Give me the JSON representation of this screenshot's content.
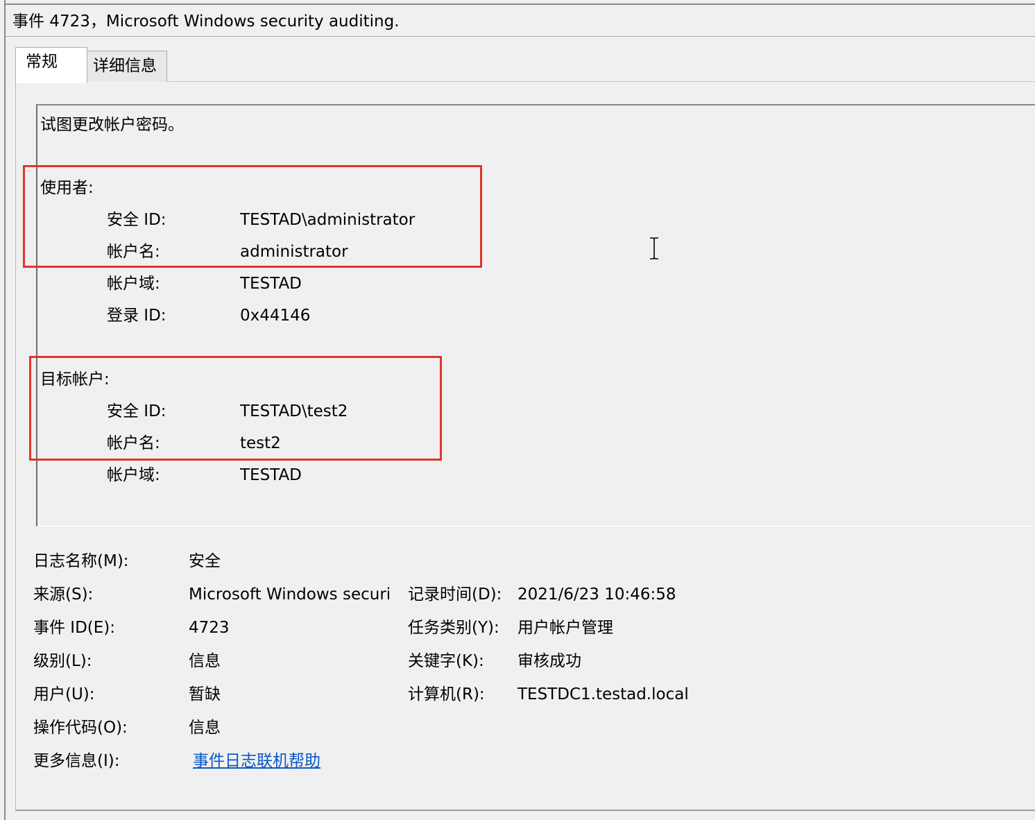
{
  "window": {
    "title": "事件 4723，Microsoft Windows security auditing."
  },
  "tabs": [
    {
      "label": "常规",
      "active": true
    },
    {
      "label": "详细信息",
      "active": false
    }
  ],
  "description": {
    "summary": "试图更改帐户密码。",
    "subject": {
      "heading": "使用者:",
      "fields": [
        {
          "label": "安全 ID:",
          "value": "TESTAD\\administrator"
        },
        {
          "label": "帐户名:",
          "value": "administrator"
        },
        {
          "label": "帐户域:",
          "value": "TESTAD"
        },
        {
          "label": "登录 ID:",
          "value": "0x44146"
        }
      ]
    },
    "target": {
      "heading": "目标帐户:",
      "fields": [
        {
          "label": "安全 ID:",
          "value": "TESTAD\\test2"
        },
        {
          "label": "帐户名:",
          "value": "test2"
        },
        {
          "label": "帐户域:",
          "value": "TESTAD"
        }
      ]
    },
    "highlight_color": "#e0342b"
  },
  "properties": {
    "log_name": {
      "label": "日志名称(M):",
      "value": "安全"
    },
    "source": {
      "label": "来源(S):",
      "value": "Microsoft Windows securi"
    },
    "logged": {
      "label": "记录时间(D):",
      "value": "2021/6/23 10:46:58"
    },
    "event_id": {
      "label": "事件 ID(E):",
      "value": "4723"
    },
    "task_category": {
      "label": "任务类别(Y):",
      "value": "用户帐户管理"
    },
    "level": {
      "label": "级别(L):",
      "value": "信息"
    },
    "keywords": {
      "label": "关键字(K):",
      "value": "审核成功"
    },
    "user": {
      "label": "用户(U):",
      "value": "暂缺"
    },
    "computer": {
      "label": "计算机(R):",
      "value": "TESTDC1.testad.local"
    },
    "opcode": {
      "label": "操作代码(O):",
      "value": "信息"
    },
    "more_info": {
      "label": "更多信息(I):",
      "link": "事件日志联机帮助"
    }
  },
  "colors": {
    "link": "#0a56c6",
    "background": "#f0f0f0"
  },
  "icons": {
    "cursor": "ibeam-cursor-icon"
  }
}
